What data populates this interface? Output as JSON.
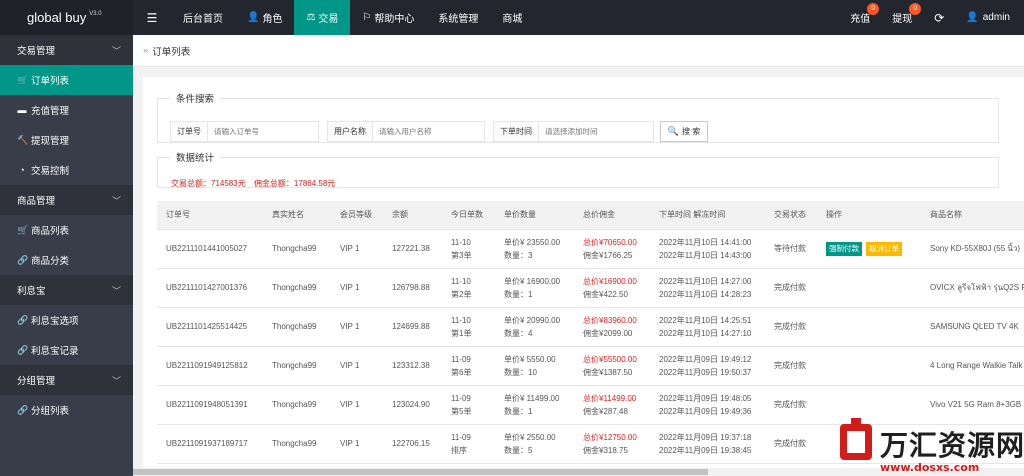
{
  "app": {
    "name": "global buy",
    "version": "V3.0"
  },
  "topnav": {
    "menu_icon": "menu-icon",
    "items": [
      {
        "label": "后台首页",
        "icon": ""
      },
      {
        "label": "角色",
        "icon": "user-icon"
      },
      {
        "label": "交易",
        "icon": "scale-icon"
      },
      {
        "label": "帮助中心",
        "icon": "flag-icon"
      },
      {
        "label": "系统管理",
        "icon": ""
      },
      {
        "label": "商城",
        "icon": ""
      }
    ],
    "active_index": 2,
    "right": {
      "recharge_label": "充值",
      "recharge_badge": "0",
      "withdraw_label": "提现",
      "withdraw_badge": "0",
      "refresh_icon": "refresh-icon",
      "user_label": "admin"
    }
  },
  "sidebar": {
    "groups": [
      {
        "label": "交易管理",
        "items": [
          "订单列表",
          "充值管理",
          "提现管理",
          "交易控制"
        ]
      },
      {
        "label": "商品管理",
        "items": [
          "商品列表",
          "商品分类"
        ]
      },
      {
        "label": "利息宝",
        "items": [
          "利息宝选项",
          "利息宝记录"
        ]
      },
      {
        "label": "分组管理",
        "items": [
          "分组列表"
        ]
      }
    ],
    "active_item": "订单列表"
  },
  "breadcrumb": {
    "separator": "»",
    "label": "订单列表"
  },
  "search": {
    "legend": "条件搜索",
    "order_no": {
      "label": "订单号",
      "placeholder": "请输入订单号"
    },
    "username": {
      "label": "用户名称",
      "placeholder": "请输入用户名称"
    },
    "order_time": {
      "label": "下单时间",
      "placeholder": "请选择添加时间"
    },
    "button": "搜 索"
  },
  "stats": {
    "legend": "数据统计",
    "total_trade": "交易总额：714583元",
    "total_commission": "佣金总额：17864.58元"
  },
  "table": {
    "columns": [
      "订单号",
      "真实姓名",
      "会员等级",
      "余额",
      "今日单数",
      "单价数量",
      "总价佣金",
      "下单时间 解冻时间",
      "交易状态",
      "操作",
      "商品名称"
    ],
    "actions": {
      "force_pay": "强制付款",
      "cancel": "取消订单"
    },
    "rows": [
      {
        "order_no": "UB2211101441005027",
        "name": "Thongcha99",
        "level": "VIP 1",
        "balance": "127221.38",
        "day": "11-10",
        "count": "第3单",
        "price": "单价¥  23550.00",
        "qty": "数量：3",
        "total": "总价¥70650.00",
        "commission": "佣金¥1766.25",
        "order_time": "2022年11月10日 14:41:00",
        "unfreeze_time": "2022年11月10日 14:43:00",
        "status": "等待付款",
        "has_actions": true,
        "product": "Sony KD-55X80J (55 นิ้ว)"
      },
      {
        "order_no": "UB2211101427001376",
        "name": "Thongcha99",
        "level": "VIP 1",
        "balance": "126798.88",
        "day": "11-10",
        "count": "第2单",
        "price": "单价¥  16900.00",
        "qty": "数量：1",
        "total": "总价¥16900.00",
        "commission": "佣金¥422.50",
        "order_time": "2022年11月10日 14:27:00",
        "unfreeze_time": "2022年11月10日 14:28:23",
        "status": "完成付款",
        "has_actions": false,
        "product": "OVICX ลูรีจโฟฟ้า รุ่นQ2S Pr"
      },
      {
        "order_no": "UB2211101425514425",
        "name": "Thongcha99",
        "level": "VIP 1",
        "balance": "124699.88",
        "day": "11-10",
        "count": "第1单",
        "price": "单价¥  20990.00",
        "qty": "数量：4",
        "total": "总价¥83960.00",
        "commission": "佣金¥2099.00",
        "order_time": "2022年11月10日 14:25:51",
        "unfreeze_time": "2022年11月10日 14:27:10",
        "status": "完成付款",
        "has_actions": false,
        "product": "SAMSUNG QLED TV 4K"
      },
      {
        "order_no": "UB2211091949125812",
        "name": "Thongcha99",
        "level": "VIP 1",
        "balance": "123312.38",
        "day": "11-09",
        "count": "第6单",
        "price": "单价¥  5550.00",
        "qty": "数量：10",
        "total": "总价¥55500.00",
        "commission": "佣金¥1387.50",
        "order_time": "2022年11月09日 19:49:12",
        "unfreeze_time": "2022年11月09日 19:50:37",
        "status": "完成付款",
        "has_actions": false,
        "product": "4 Long Range Walkie Talk"
      },
      {
        "order_no": "UB2211091948051391",
        "name": "Thongcha99",
        "level": "VIP 1",
        "balance": "123024.90",
        "day": "11-09",
        "count": "第5单",
        "price": "单价¥  11499.00",
        "qty": "数量：1",
        "total": "总价¥11499.00",
        "commission": "佣金¥287.48",
        "order_time": "2022年11月09日 19:48:05",
        "unfreeze_time": "2022年11月09日 19:49:36",
        "status": "完成付款",
        "has_actions": false,
        "product": "Vivo V21 5G Ram 8+3GB"
      },
      {
        "order_no": "UB2211091937189717",
        "name": "Thongcha99",
        "level": "VIP 1",
        "balance": "122706.15",
        "day": "11-09",
        "count": "排序",
        "price": "单价¥  2550.00",
        "qty": "数量：5",
        "total": "总价¥12750.00",
        "commission": "佣金¥318.75",
        "order_time": "2022年11月09日 19:37:18",
        "unfreeze_time": "2022年11月09日 19:38:45",
        "status": "完成付款",
        "has_actions": false,
        "product": ""
      }
    ]
  },
  "watermark": {
    "text": "万汇资源网",
    "url": "www.dosxs.com"
  }
}
